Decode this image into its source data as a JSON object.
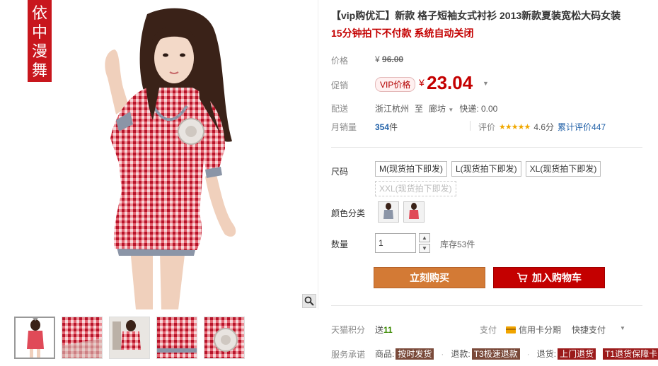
{
  "brand_seal": [
    "依",
    "中",
    "漫",
    "舞"
  ],
  "product": {
    "title": "【vip购优汇】新款 格子短袖女式衬衫 2013新款夏装宽松大码女装",
    "subtitle": "15分钟拍下不付款 系统自动关闭"
  },
  "price": {
    "label": "价格",
    "currency": "¥",
    "original": "96.00"
  },
  "promo": {
    "label": "促销",
    "badge": "VIP价格",
    "currency": "¥",
    "price": "23.04"
  },
  "shipping": {
    "label": "配送",
    "from": "浙江杭州",
    "to_word": "至",
    "destination": "廊坊",
    "fee": "快递: 0.00"
  },
  "sales": {
    "label": "月销量",
    "count": "354",
    "unit": "件",
    "rating_label": "评价",
    "stars": "★★★★★",
    "score": "4.6分",
    "reviews": "累计评价447"
  },
  "size": {
    "label": "尺码",
    "options": [
      {
        "text": "M(现货拍下即发)",
        "disabled": false
      },
      {
        "text": "L(现货拍下即发)",
        "disabled": false
      },
      {
        "text": "XL(现货拍下即发)",
        "disabled": false
      },
      {
        "text": "XXL(现货拍下即发)",
        "disabled": true
      }
    ]
  },
  "color": {
    "label": "颜色分类"
  },
  "quantity": {
    "label": "数量",
    "value": "1",
    "stock": "库存53件"
  },
  "actions": {
    "buy": "立刻购买",
    "cart": "加入购物车"
  },
  "points": {
    "label": "天猫积分",
    "prefix": "送",
    "value": "11"
  },
  "payment": {
    "label": "支付",
    "credit": "信用卡分期",
    "quick": "快捷支付"
  },
  "promise": {
    "label": "服务承诺",
    "items": [
      {
        "prefix": "商品:",
        "tag": "按时发货"
      },
      {
        "prefix": "退款:",
        "tag": "T3极速退款"
      },
      {
        "prefix": "退货:",
        "tag": "上门退货"
      },
      {
        "prefix": "",
        "tag": "T1退货保障卡"
      }
    ]
  },
  "colors": {
    "accent_red": "#c40000",
    "buy_orange": "#d37a35",
    "link_blue": "#2161a8"
  }
}
